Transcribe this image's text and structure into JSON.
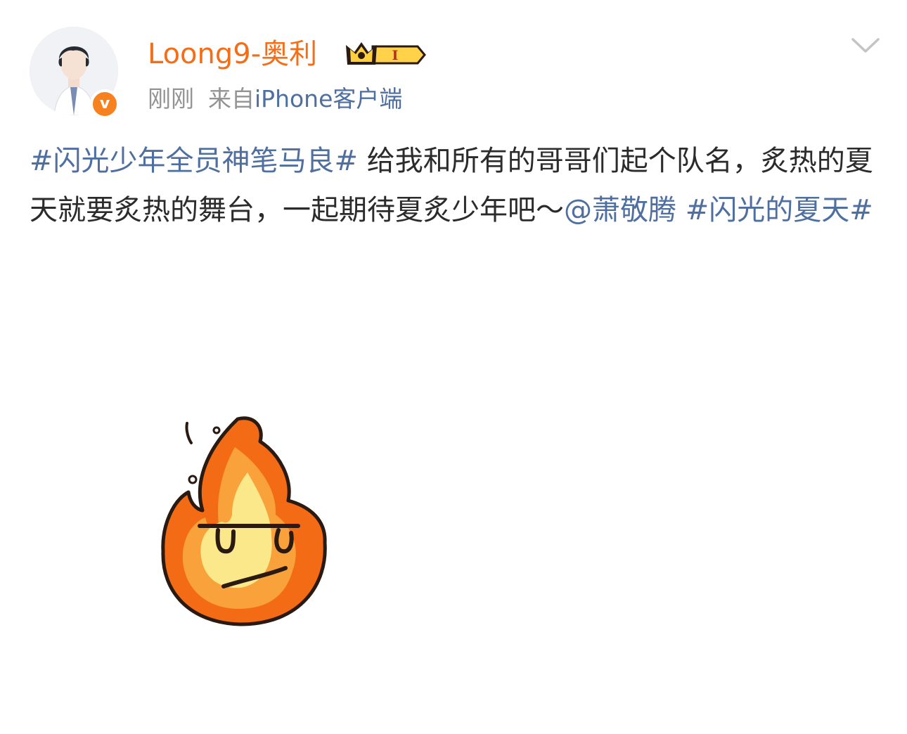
{
  "post": {
    "author": {
      "name": "Loong9-奥利",
      "verified_mark": "v",
      "vip_level": "I",
      "avatar_icon": "avatar-photo"
    },
    "meta": {
      "time": "刚刚",
      "source_prefix": "来自",
      "source_device": "iPhone客户端"
    },
    "menu_icon": "chevron-down-icon",
    "content": {
      "hashtag_1": "#闪光少年全员神笔马良#",
      "text_1": " 给我和所有的哥哥们起个队名，炙热的夏天就要炙热的舞台，一起期待夏炙少年吧～",
      "mention": "@萧敬腾",
      "text_2": " ",
      "hashtag_2": "#闪光的夏天#"
    },
    "image": {
      "icon": "fire-sticker",
      "colors": {
        "outer": "#f36b14",
        "middle": "#f9a13a",
        "inner": "#fbe88a",
        "outline": "#2a1a12"
      }
    }
  },
  "colors": {
    "username": "#f56e16",
    "link": "#4e6fa0",
    "text": "#2b2b2b",
    "meta": "#939393",
    "badge": "#f7811e"
  }
}
